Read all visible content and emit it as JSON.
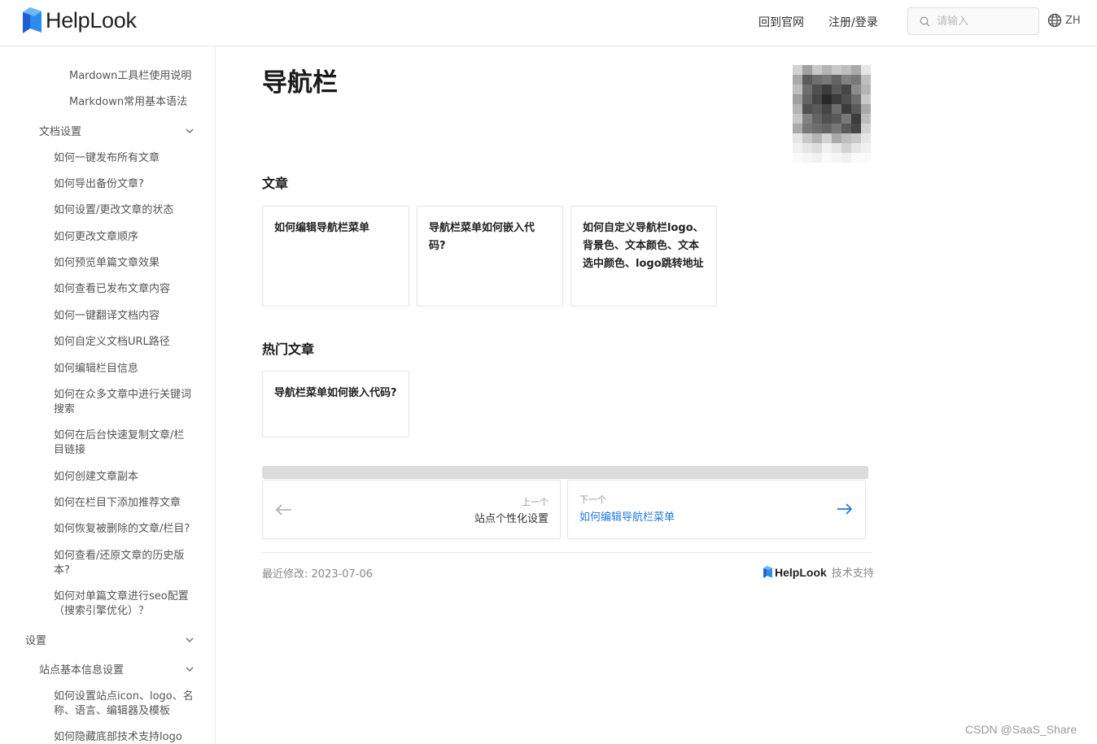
{
  "header": {
    "logo_text": "HelpLook",
    "nav": [
      "回到官网",
      "注册/登录"
    ],
    "search_placeholder": "请输入",
    "lang": "ZH"
  },
  "sidebar": {
    "top_items": [
      "Mardown工具栏使用说明",
      "Markdown常用基本语法"
    ],
    "group_doc_settings": "文档设置",
    "doc_items": [
      "如何一键发布所有文章",
      "如何导出备份文章?",
      "如何设置/更改文章的状态",
      "如何更改文章顺序",
      "如何预览单篇文章效果",
      "如何查看已发布文章内容",
      "如何一键翻译文档内容",
      "如何自定义文档URL路径",
      "如何编辑栏目信息",
      "如何在众多文章中进行关键词搜索",
      "如何在后台快速复制文章/栏目链接",
      "如何创建文章副本",
      "如何在栏目下添加推荐文章",
      "如何恢复被删除的文章/栏目?",
      "如何查看/还原文章的历史版本?",
      "如何对单篇文章进行seo配置（搜索引擎优化）？"
    ],
    "group_settings": "设置",
    "group_site_basic": "站点基本信息设置",
    "site_items": [
      "如何设置站点icon、logo、名称、语言、编辑器及模板",
      "如何隐藏底部技术支持logo"
    ]
  },
  "main": {
    "title": "导航栏",
    "articles_heading": "文章",
    "articles": [
      "如何编辑导航栏菜单",
      "导航栏菜单如何嵌入代码?",
      "如何自定义导航栏logo、背景色、文本颜色、文本选中颜色、logo跳转地址"
    ],
    "hot_heading": "热门文章",
    "hot_articles": [
      "导航栏菜单如何嵌入代码?"
    ],
    "prev_label": "上一个",
    "prev_title": "站点个性化设置",
    "next_label": "下一个",
    "next_title": "如何编辑导航栏菜单",
    "modified": "最近修改: 2023-07-06",
    "support_brand": "HelpLook",
    "support_text": "技术支持"
  },
  "watermark": "CSDN @SaaS_Share",
  "colors": {
    "accent": "#1f7ae0",
    "logo_blue": "#1a73e8"
  }
}
